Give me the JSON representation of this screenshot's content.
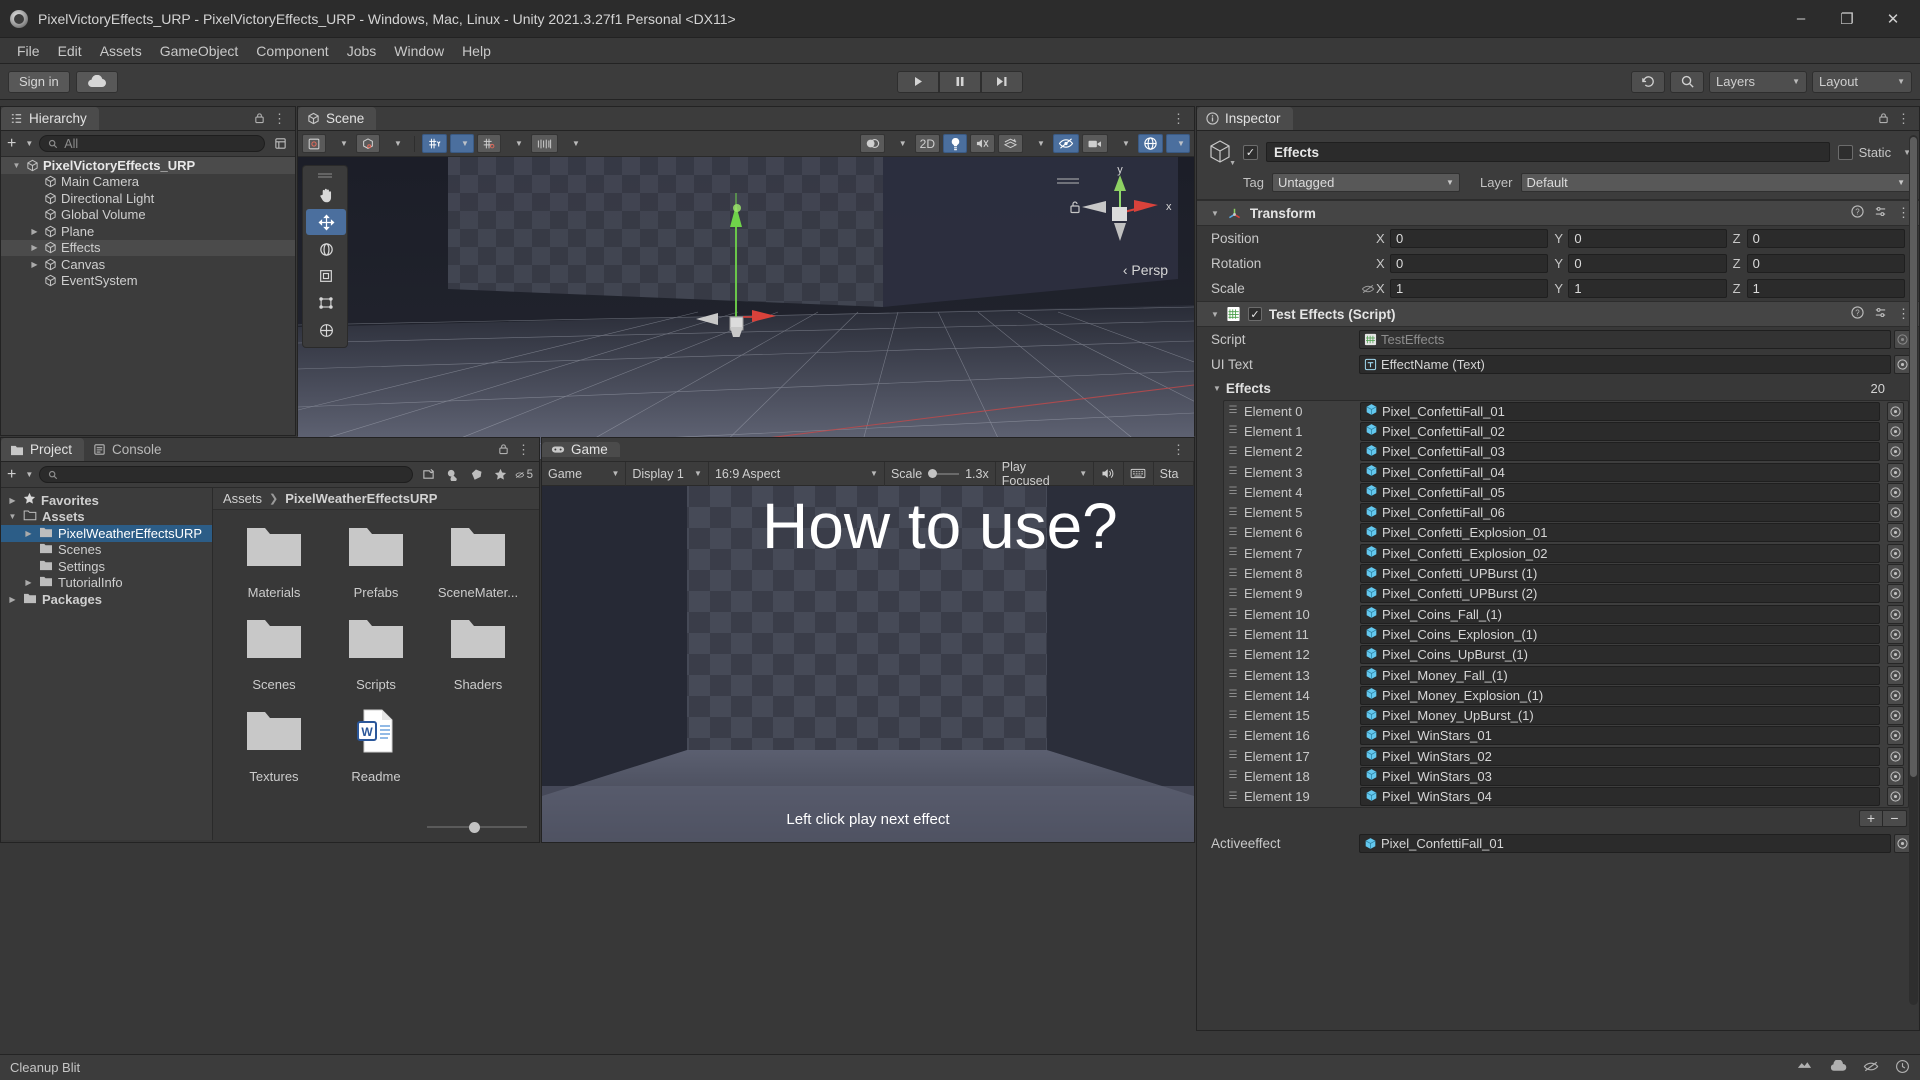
{
  "window": {
    "title": "PixelVictoryEffects_URP - PixelVictoryEffects_URP - Windows, Mac, Linux - Unity 2021.3.27f1 Personal <DX11>",
    "minimize": "–",
    "maximize": "❐",
    "close": "✕"
  },
  "menubar": {
    "items": [
      "File",
      "Edit",
      "Assets",
      "GameObject",
      "Component",
      "Jobs",
      "Window",
      "Help"
    ]
  },
  "toolbar": {
    "signin_label": "Sign in",
    "cloud_icon": "cloud-icon",
    "play_icon": "▶",
    "pause_icon": "‖",
    "step_icon": "▶|",
    "history_icon": "undo-history-icon",
    "search_icon": "search-icon",
    "layers_label": "Layers",
    "layout_label": "Layout"
  },
  "hierarchy": {
    "tab": "Hierarchy",
    "tab_icon": "hierarchy-icon",
    "add_label": "+",
    "search_placeholder": "All",
    "items": [
      {
        "label": "PixelVictoryEffects_URP",
        "depth": 0,
        "expanded": true,
        "root": true,
        "arrow": "▼"
      },
      {
        "label": "Main Camera",
        "depth": 1,
        "arrow": ""
      },
      {
        "label": "Directional Light",
        "depth": 1,
        "arrow": ""
      },
      {
        "label": "Global Volume",
        "depth": 1,
        "arrow": ""
      },
      {
        "label": "Plane",
        "depth": 1,
        "arrow": "▶"
      },
      {
        "label": "Effects",
        "depth": 1,
        "arrow": "▶",
        "selected": true
      },
      {
        "label": "Canvas",
        "depth": 1,
        "arrow": "▶"
      },
      {
        "label": "EventSystem",
        "depth": 1,
        "arrow": ""
      }
    ]
  },
  "scene": {
    "tab": "Scene",
    "tab_icon": "scene-icon",
    "toolbar": {
      "shading_label": "Shaded",
      "mode_2d": "2D",
      "persp_label": "‹ Persp",
      "axis_y": "y",
      "axis_x": "x"
    },
    "tools": [
      "hand-tool",
      "move-tool",
      "rotate-tool",
      "scale-tool",
      "rect-tool",
      "transform-tool"
    ]
  },
  "project": {
    "tab": "Project",
    "console_tab": "Console",
    "search_placeholder": "",
    "favorites_count": "5",
    "tree": [
      {
        "label": "Favorites",
        "depth": 0,
        "arrow": "▶",
        "icon": "star-icon"
      },
      {
        "label": "Assets",
        "depth": 0,
        "arrow": "▼",
        "icon": "folder-open-icon"
      },
      {
        "label": "PixelWeatherEffectsURP",
        "depth": 1,
        "arrow": "▶",
        "icon": "folder-icon",
        "selected": true
      },
      {
        "label": "Scenes",
        "depth": 1,
        "arrow": "",
        "icon": "folder-icon"
      },
      {
        "label": "Settings",
        "depth": 1,
        "arrow": "",
        "icon": "folder-icon"
      },
      {
        "label": "TutorialInfo",
        "depth": 1,
        "arrow": "▶",
        "icon": "folder-icon"
      },
      {
        "label": "Packages",
        "depth": 0,
        "arrow": "▶",
        "icon": "folder-icon"
      }
    ],
    "breadcrumb": [
      "Assets",
      "PixelWeatherEffectsURP"
    ],
    "assets": [
      {
        "label": "Materials",
        "type": "folder"
      },
      {
        "label": "Prefabs",
        "type": "folder"
      },
      {
        "label": "SceneMater...",
        "type": "folder"
      },
      {
        "label": "Scenes",
        "type": "folder"
      },
      {
        "label": "Scripts",
        "type": "folder"
      },
      {
        "label": "Shaders",
        "type": "folder"
      },
      {
        "label": "Textures",
        "type": "folder"
      },
      {
        "label": "Readme",
        "type": "word-doc"
      }
    ]
  },
  "game": {
    "tab": "Game",
    "tab_icon": "gamepad-icon",
    "toolbar": {
      "view_mode": "Game",
      "display": "Display 1",
      "aspect": "16:9 Aspect",
      "scale_label": "Scale",
      "scale_value": "1.3x",
      "play_mode": "Play Focused",
      "mute_icon": "speaker-icon",
      "stats_partial": "Sta"
    },
    "overlay_heading": "How to use?",
    "overlay_footer": "Left click play next effect"
  },
  "inspector": {
    "tab": "Inspector",
    "tab_icon": "info-icon",
    "object_name": "Effects",
    "enabled": true,
    "static_label": "Static",
    "tag_label": "Tag",
    "tag_value": "Untagged",
    "layer_label": "Layer",
    "layer_value": "Default",
    "transform": {
      "title": "Transform",
      "rows": [
        {
          "label": "Position",
          "x": "0",
          "y": "0",
          "z": "0"
        },
        {
          "label": "Rotation",
          "x": "0",
          "y": "0",
          "z": "0"
        },
        {
          "label": "Scale",
          "x": "1",
          "y": "1",
          "z": "1",
          "link_icon": "constrain-proportions-icon"
        }
      ]
    },
    "script_component": {
      "title": "Test Effects (Script)",
      "enabled": true,
      "script_label": "Script",
      "script_value": "TestEffects",
      "uitext_label": "UI Text",
      "uitext_value": "EffectName (Text)",
      "array_label": "Effects",
      "array_size": "20",
      "elements": [
        {
          "label": "Element 0",
          "value": "Pixel_ConfettiFall_01"
        },
        {
          "label": "Element 1",
          "value": "Pixel_ConfettiFall_02"
        },
        {
          "label": "Element 2",
          "value": "Pixel_ConfettiFall_03"
        },
        {
          "label": "Element 3",
          "value": "Pixel_ConfettiFall_04"
        },
        {
          "label": "Element 4",
          "value": "Pixel_ConfettiFall_05"
        },
        {
          "label": "Element 5",
          "value": "Pixel_ConfettiFall_06"
        },
        {
          "label": "Element 6",
          "value": "Pixel_Confetti_Explosion_01"
        },
        {
          "label": "Element 7",
          "value": "Pixel_Confetti_Explosion_02"
        },
        {
          "label": "Element 8",
          "value": "Pixel_Confetti_UPBurst (1)"
        },
        {
          "label": "Element 9",
          "value": "Pixel_Confetti_UPBurst (2)"
        },
        {
          "label": "Element 10",
          "value": "Pixel_Coins_Fall_(1)"
        },
        {
          "label": "Element 11",
          "value": "Pixel_Coins_Explosion_(1)"
        },
        {
          "label": "Element 12",
          "value": "Pixel_Coins_UpBurst_(1)"
        },
        {
          "label": "Element 13",
          "value": "Pixel_Money_Fall_(1)"
        },
        {
          "label": "Element 14",
          "value": "Pixel_Money_Explosion_(1)"
        },
        {
          "label": "Element 15",
          "value": "Pixel_Money_UpBurst_(1)"
        },
        {
          "label": "Element 16",
          "value": "Pixel_WinStars_01"
        },
        {
          "label": "Element 17",
          "value": "Pixel_WinStars_02"
        },
        {
          "label": "Element 18",
          "value": "Pixel_WinStars_03"
        },
        {
          "label": "Element 19",
          "value": "Pixel_WinStars_04"
        }
      ],
      "add_label": "+",
      "remove_label": "−",
      "activeeffect_label": "Activeeffect",
      "activeeffect_value": "Pixel_ConfettiFall_01"
    }
  },
  "statusbar": {
    "message": "Cleanup Blit"
  },
  "colors": {
    "accent_blue": "#2c5d87",
    "toolbar_on": "#4b6f9e",
    "panel_bg": "#383838",
    "panel_head": "#3c3c3c",
    "unity_cube_blue": "#63c8ef"
  }
}
